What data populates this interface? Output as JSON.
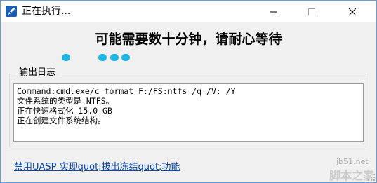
{
  "window": {
    "title": "正在执行...",
    "controls": {
      "minimize_icon": "minimize-icon",
      "maximize_icon": "maximize-icon",
      "close_icon": "close-icon"
    }
  },
  "main": {
    "headline": "可能需要数十分钟，请耐心等待",
    "progress_dots_color": "#1eb4e6"
  },
  "output": {
    "group_label": "输出日志",
    "lines": [
      "Command:cmd.exe/c format F:/FS:ntfs /q /V: /Y",
      "文件系统的类型是 NTFS。",
      "正在快速格式化 15.0 GB",
      "正在创建文件系统结构。"
    ]
  },
  "footer": {
    "link_text": "禁用UASP 实现quot;拔出冻结quot;功能"
  },
  "watermark": {
    "url": "jb51.net",
    "name": "脚本之家"
  }
}
